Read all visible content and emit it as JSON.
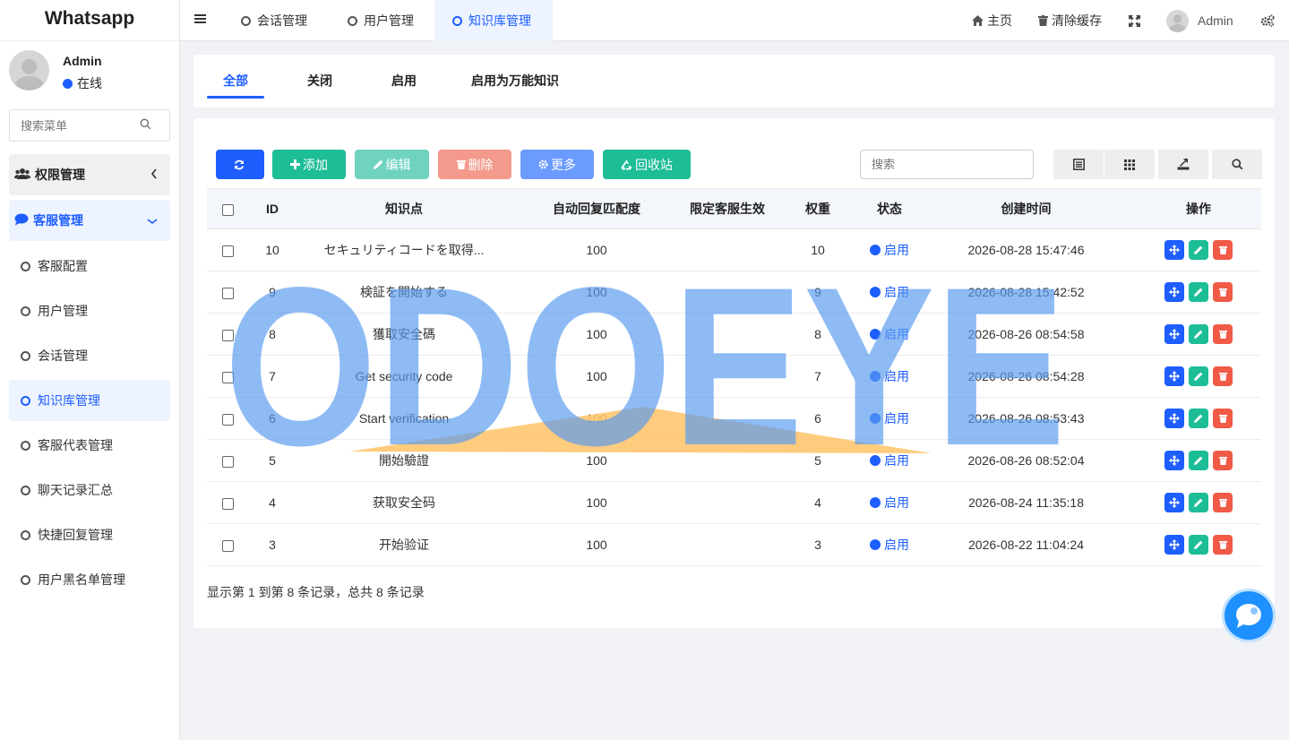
{
  "app": {
    "logo": "Whatsapp"
  },
  "user": {
    "name": "Admin",
    "status": "在线"
  },
  "sidebar": {
    "search_placeholder": "搜索菜单",
    "groups": [
      {
        "label": "权限管理",
        "icon": "users-icon",
        "expanded": false
      },
      {
        "label": "客服管理",
        "icon": "comment-icon",
        "expanded": true
      }
    ],
    "items": [
      {
        "label": "客服配置",
        "active": false
      },
      {
        "label": "用户管理",
        "active": false
      },
      {
        "label": "会话管理",
        "active": false
      },
      {
        "label": "知识库管理",
        "active": true
      },
      {
        "label": "客服代表管理",
        "active": false
      },
      {
        "label": "聊天记录汇总",
        "active": false
      },
      {
        "label": "快捷回复管理",
        "active": false
      },
      {
        "label": "用户黑名单管理",
        "active": false
      }
    ]
  },
  "header": {
    "tabs": [
      {
        "label": "会话管理",
        "active": false
      },
      {
        "label": "用户管理",
        "active": false
      },
      {
        "label": "知识库管理",
        "active": true
      }
    ],
    "home": "主页",
    "clear_cache": "清除缓存",
    "admin": "Admin"
  },
  "filter_tabs": [
    {
      "label": "全部",
      "active": true
    },
    {
      "label": "关闭",
      "active": false
    },
    {
      "label": "启用",
      "active": false
    },
    {
      "label": "启用为万能知识",
      "active": false
    }
  ],
  "toolbar": {
    "add": "添加",
    "edit": "编辑",
    "delete": "删除",
    "more": "更多",
    "recycle": "回收站",
    "search_placeholder": "搜索"
  },
  "table": {
    "columns": [
      "ID",
      "知识点",
      "自动回复匹配度",
      "限定客服生效",
      "权重",
      "状态",
      "创建时间",
      "操作"
    ],
    "rows": [
      {
        "id": "10",
        "point": "セキュリティコードを取得...",
        "match": "100",
        "limit": "",
        "weight": "10",
        "status": "启用",
        "created": "2026-08-28 15:47:46"
      },
      {
        "id": "9",
        "point": "検証を開始する",
        "match": "100",
        "limit": "",
        "weight": "9",
        "status": "启用",
        "created": "2026-08-28 15:42:52"
      },
      {
        "id": "8",
        "point": "獲取安全碼",
        "match": "100",
        "limit": "",
        "weight": "8",
        "status": "启用",
        "created": "2026-08-26 08:54:58"
      },
      {
        "id": "7",
        "point": "Get security code",
        "match": "100",
        "limit": "",
        "weight": "7",
        "status": "启用",
        "created": "2026-08-26 08:54:28"
      },
      {
        "id": "6",
        "point": "Start verification",
        "match": "100",
        "limit": "",
        "weight": "6",
        "status": "启用",
        "created": "2026-08-26 08:53:43"
      },
      {
        "id": "5",
        "point": "開始驗證",
        "match": "100",
        "limit": "",
        "weight": "5",
        "status": "启用",
        "created": "2026-08-26 08:52:04"
      },
      {
        "id": "4",
        "point": "获取安全码",
        "match": "100",
        "limit": "",
        "weight": "4",
        "status": "启用",
        "created": "2026-08-24 11:35:18"
      },
      {
        "id": "3",
        "point": "开始验证",
        "match": "100",
        "limit": "",
        "weight": "3",
        "status": "启用",
        "created": "2026-08-22 11:04:24"
      }
    ]
  },
  "pagination": {
    "summary": "显示第 1 到第 8 条记录，总共 8 条记录"
  },
  "watermark": {
    "text": "ODOEYE"
  },
  "colors": {
    "primary": "#1e5eff",
    "success": "#1cbd97",
    "danger": "#f05a46",
    "edit_disabled": "#6fd3c0",
    "delete_disabled": "#f39a8d",
    "more": "#6c9bff",
    "watermark": "#5a9bf0",
    "watermark_accent": "#ffc670"
  }
}
